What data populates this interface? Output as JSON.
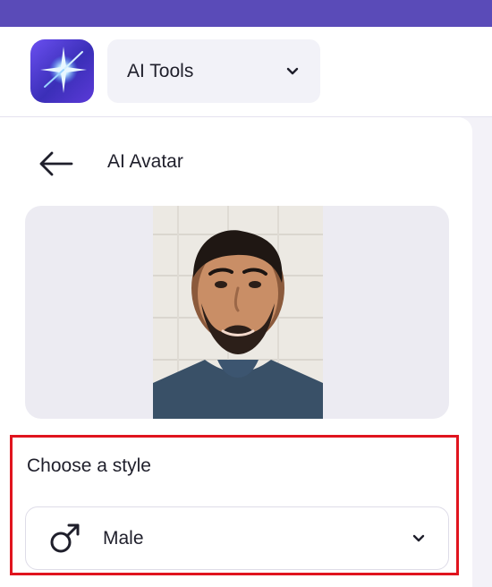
{
  "header": {
    "logo_icon": "sparkle-logo-icon",
    "tool_selector": {
      "label": "AI Tools",
      "icon": "chevron-down-icon"
    }
  },
  "panel": {
    "back_icon": "arrow-left-icon",
    "title": "AI Avatar",
    "preview": {
      "image_description_icon": "avatar-photo"
    },
    "style": {
      "heading": "Choose a style",
      "selected": "Male",
      "selected_icon": "male-symbol-icon",
      "chevron_icon": "chevron-down-icon"
    }
  },
  "colors": {
    "top_bar": "#5a4bb8",
    "highlight": "#e0141e",
    "text": "#1f1f2b",
    "panel_bg": "#f3f2f8"
  }
}
